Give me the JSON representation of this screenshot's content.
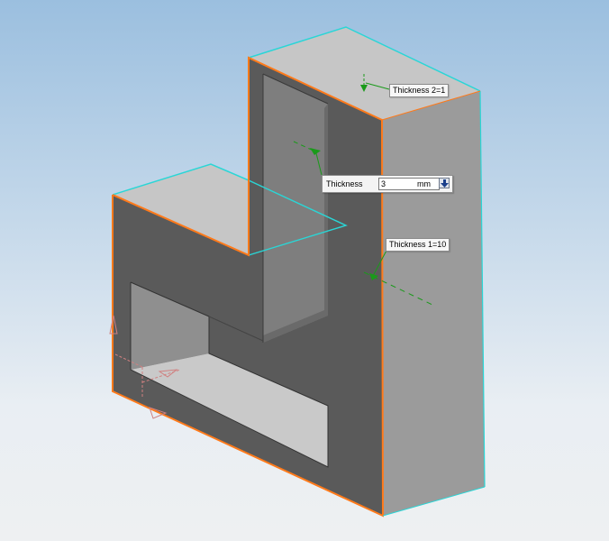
{
  "scene": {
    "background_top": "#9bbfdf",
    "background_bottom": "#eef0f2",
    "edge_highlight_color": "#ff7a1a",
    "selection_color": "#2ad6d6",
    "handle_color": "#1a9a1a"
  },
  "callouts": {
    "thickness_2": "Thickness 2=1",
    "thickness_1": "Thickness 1=10"
  },
  "thickness_input": {
    "label": "Thickness",
    "value": "3",
    "unit": "mm",
    "dropdown_icon": "arrow-down-icon"
  }
}
